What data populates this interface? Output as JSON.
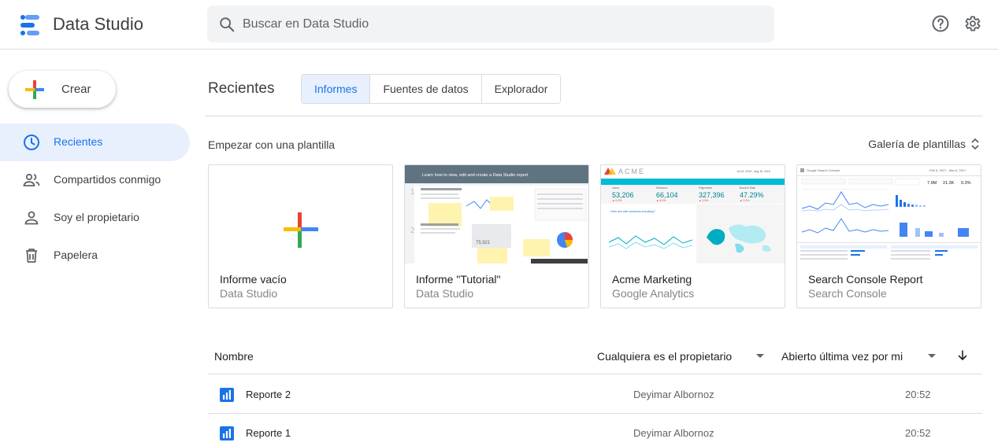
{
  "header": {
    "app_title": "Data Studio",
    "search_placeholder": "Buscar en Data Studio",
    "icons": [
      "help-icon",
      "settings-icon"
    ]
  },
  "sidebar": {
    "create_label": "Crear",
    "items": [
      {
        "label": "Recientes",
        "icon": "clock-icon",
        "active": true
      },
      {
        "label": "Compartidos conmigo",
        "icon": "people-icon",
        "active": false
      },
      {
        "label": "Soy el propietario",
        "icon": "person-icon",
        "active": false
      },
      {
        "label": "Papelera",
        "icon": "trash-icon",
        "active": false
      }
    ]
  },
  "main": {
    "title": "Recientes",
    "tabs": [
      {
        "label": "Informes",
        "active": true
      },
      {
        "label": "Fuentes de datos",
        "active": false
      },
      {
        "label": "Explorador",
        "active": false
      }
    ],
    "templates_heading": "Empezar con una plantilla",
    "gallery_label": "Galería de plantillas",
    "templates": [
      {
        "title": "Informe vacío",
        "subtitle": "Data Studio"
      },
      {
        "title": "Informe \"Tutorial\"",
        "subtitle": "Data Studio",
        "thumb": {
          "banner": "Learn how to view, edit and create a Data Studio report",
          "metric": "75,921"
        }
      },
      {
        "title": "Acme Marketing",
        "subtitle": "Google Analytics",
        "thumb": {
          "brand": "ACME",
          "dates": "Jul 19, 2016 - Aug 15, 2016",
          "kpis": [
            {
              "label": "Users",
              "value": "53,206",
              "delta": "▲ 6.3%"
            },
            {
              "label": "Sessions",
              "value": "66,104",
              "delta": "▲ 6.3%"
            },
            {
              "label": "Pageviews",
              "value": "327,396",
              "delta": "▲ 3.5%"
            },
            {
              "label": "Bounce Rate",
              "value": "47.29%",
              "delta": "▲ 3.2%"
            }
          ],
          "q1": "How are site sessions trending?",
          "q2": "What are the top countries by sessions?"
        }
      },
      {
        "title": "Search Console Report",
        "subtitle": "Search Console",
        "thumb": {
          "brand": "Google Search Console",
          "dates": "Feb 5, 2017 - Mar 6, 2017",
          "kpis": [
            "7.9M",
            "21.3K",
            "0.3%"
          ]
        }
      }
    ],
    "list": {
      "columns": {
        "name": "Nombre",
        "owner": "Cualquiera es el propietario",
        "opened": "Abierto última vez por mi"
      },
      "rows": [
        {
          "name": "Reporte 2",
          "owner": "Deyimar Albornoz",
          "time": "20:52"
        },
        {
          "name": "Reporte 1",
          "owner": "Deyimar Albornoz",
          "time": "20:52"
        }
      ]
    }
  },
  "colors": {
    "accent": "#1a73e8",
    "active_bg": "#e8f0fe",
    "google_red": "#ea4335",
    "google_yellow": "#fbbc04",
    "google_green": "#34a853",
    "google_blue": "#4285f4"
  }
}
